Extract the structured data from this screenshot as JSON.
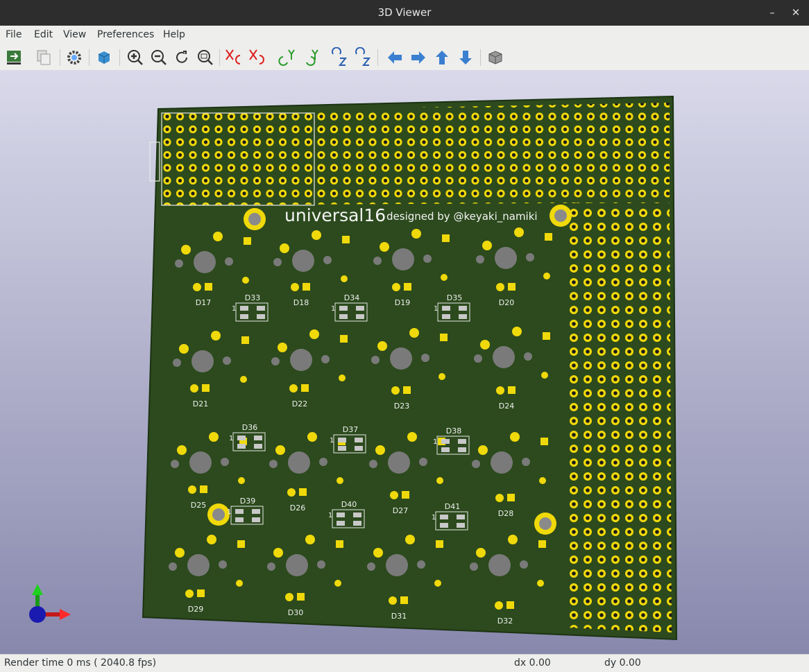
{
  "window": {
    "title": "3D Viewer",
    "minimize_glyph": "–",
    "close_glyph": "✕"
  },
  "menu": [
    "File",
    "Edit",
    "View",
    "Preferences",
    "Help"
  ],
  "toolbar_icons": [
    "pcbnew-icon",
    "copy-icon",
    "settings-icon",
    "render-mode-icon",
    "zoom-in-icon",
    "zoom-out-icon",
    "refresh-icon",
    "zoom-fit-icon",
    "rotate-x-cw-icon",
    "rotate-x-ccw-icon",
    "rotate-y-cw-icon",
    "rotate-y-ccw-icon",
    "rotate-z-cw-icon",
    "rotate-z-ccw-icon",
    "pan-left-icon",
    "pan-right-icon",
    "pan-up-icon",
    "pan-down-icon",
    "ortho-icon"
  ],
  "pcb": {
    "title": "universal16",
    "subtitle": "designed by @keyaki_namiki",
    "board_color": "#2c4a1d",
    "pad_color": "#f0d90a",
    "diodes": [
      "D17",
      "D18",
      "D19",
      "D20",
      "D21",
      "D22",
      "D23",
      "D24",
      "D25",
      "D26",
      "D27",
      "D28",
      "D29",
      "D30",
      "D31",
      "D32"
    ],
    "leds": [
      "D33",
      "D34",
      "D35",
      "D36",
      "D37",
      "D38",
      "D39",
      "D40",
      "D41"
    ],
    "pin_one_label": "1"
  },
  "status": {
    "render_time": "Render time 0 ms ( 2040.8 fps)",
    "dx": "dx 0.00",
    "dy": "dy 0.00"
  }
}
